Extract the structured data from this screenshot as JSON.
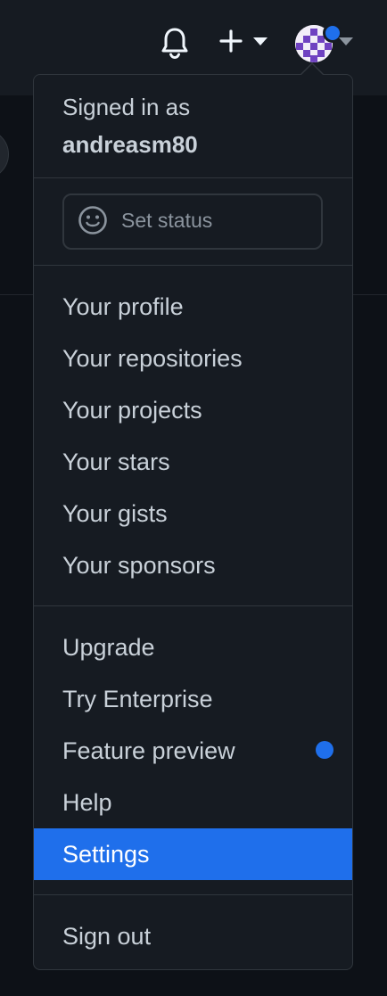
{
  "header": {
    "icons": [
      "bell-icon",
      "plus-icon",
      "caret-down-icon",
      "avatar",
      "caret-down-icon"
    ],
    "notification_color": "#1f6feb"
  },
  "menu": {
    "signed_in_label": "Signed in as",
    "username": "andreasm80",
    "status_placeholder": "Set status",
    "group1": [
      "Your profile",
      "Your repositories",
      "Your projects",
      "Your stars",
      "Your gists",
      "Your sponsors"
    ],
    "group2": [
      "Upgrade",
      "Try Enterprise",
      "Feature preview",
      "Help",
      "Settings"
    ],
    "group3": [
      "Sign out"
    ],
    "active_item": "Settings",
    "accent_color": "#1f6feb"
  }
}
